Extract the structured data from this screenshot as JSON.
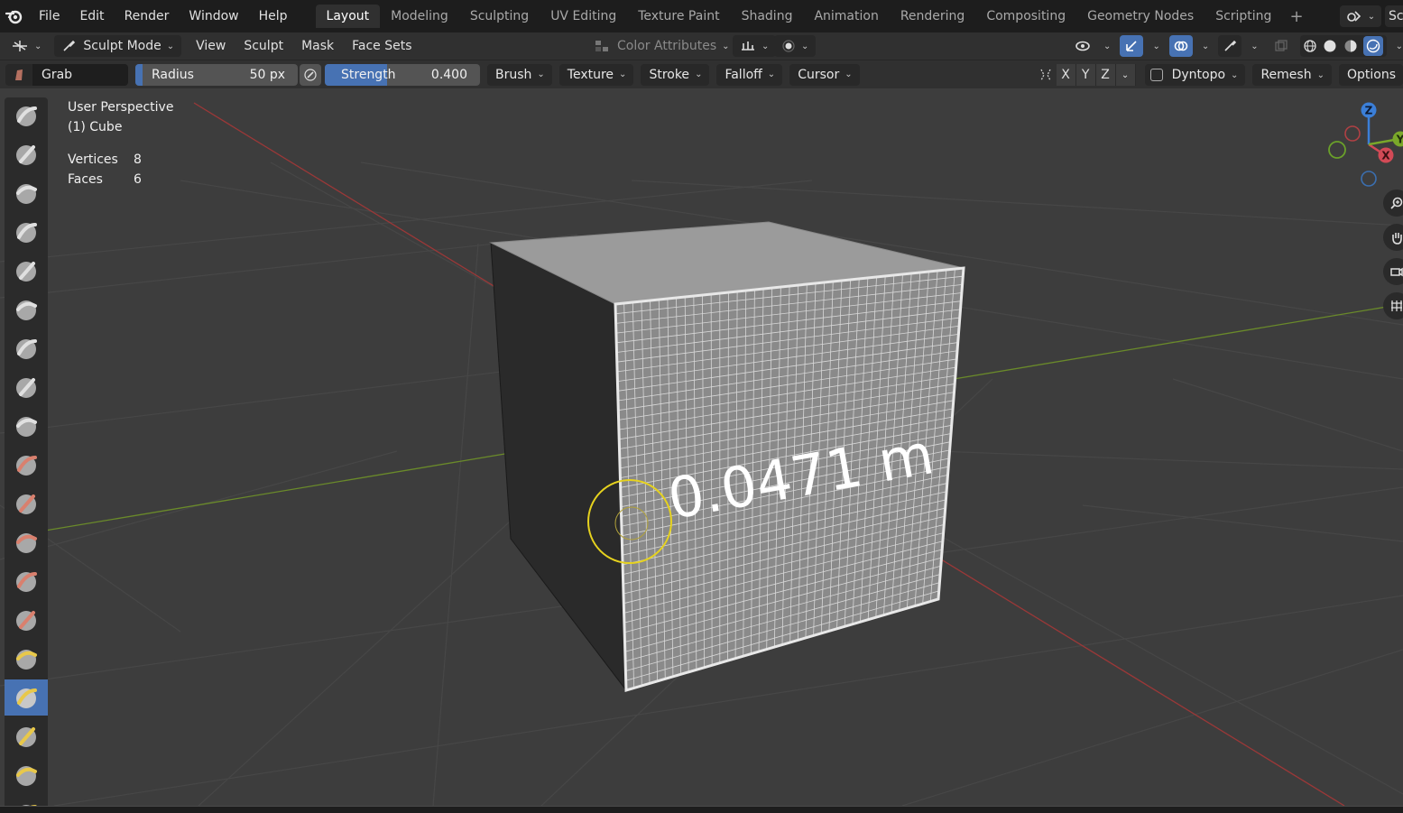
{
  "menu": [
    "File",
    "Edit",
    "Render",
    "Window",
    "Help"
  ],
  "workspaces": [
    "Layout",
    "Modeling",
    "Sculpting",
    "UV Editing",
    "Texture Paint",
    "Shading",
    "Animation",
    "Rendering",
    "Compositing",
    "Geometry Nodes",
    "Scripting"
  ],
  "active_workspace": "Layout",
  "add_workspace": "+",
  "scene_label": "Sc",
  "header": {
    "mode": "Sculpt Mode",
    "menus": [
      "View",
      "Sculpt",
      "Mask",
      "Face Sets"
    ],
    "color_attributes": "Color Attributes"
  },
  "tool_settings": {
    "brush": "Grab",
    "radius_label": "Radius",
    "radius_value": "50 px",
    "strength_label": "Strength",
    "strength_value": "0.400",
    "strength_fraction": 0.4,
    "dropdowns": [
      "Brush",
      "Texture",
      "Stroke",
      "Falloff",
      "Cursor"
    ],
    "axes": [
      "X",
      "Y",
      "Z"
    ],
    "dyntopo": "Dyntopo",
    "remesh": "Remesh",
    "options": "Options"
  },
  "viewport": {
    "perspective": "User Perspective",
    "object": "(1) Cube",
    "stats": [
      {
        "label": "Vertices",
        "value": "8"
      },
      {
        "label": "Faces",
        "value": "6"
      }
    ],
    "measure_text": "0.0471 m",
    "gizmo": {
      "z": "Z",
      "x": "X",
      "y": "Y"
    }
  },
  "colors": {
    "accent": "#4772b3",
    "grid_x": "#9b3838",
    "grid_y": "#6a8a2a",
    "brush_cursor": "#e6d21e"
  }
}
